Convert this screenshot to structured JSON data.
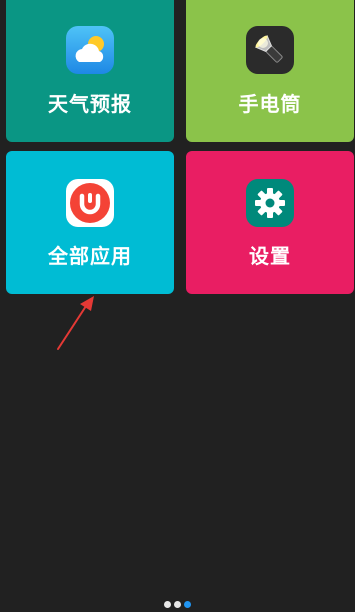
{
  "tiles": {
    "weather": {
      "label": "天气预报",
      "color": "#0a9684",
      "icon": "weather-icon"
    },
    "torch": {
      "label": "手电筒",
      "color": "#8bc34a",
      "icon": "flashlight-icon"
    },
    "apps": {
      "label": "全部应用",
      "color": "#00bcd4",
      "icon": "all-apps-icon"
    },
    "settings": {
      "label": "设置",
      "color": "#e91e63",
      "icon": "gear-icon"
    }
  },
  "annotation": {
    "arrow_color": "#e53935"
  },
  "pager": {
    "total": 3,
    "active_index": 3,
    "dot_color": "#e8e8e8",
    "active_color": "#2196f3"
  }
}
